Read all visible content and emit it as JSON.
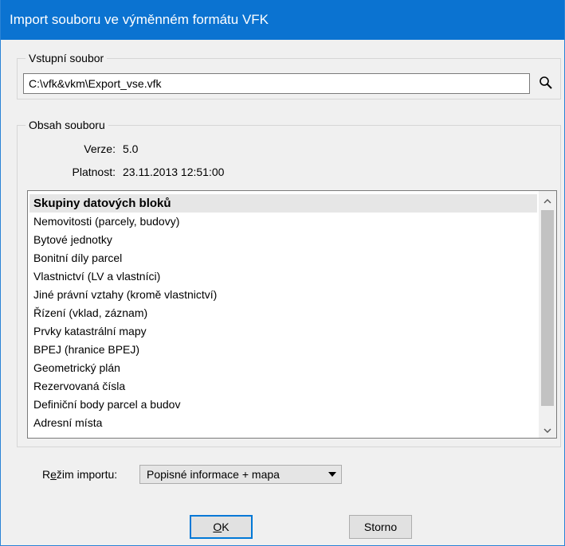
{
  "window": {
    "title": "Import souboru ve výměnném formátu VFK"
  },
  "input_file": {
    "group_label": "Vstupní soubor",
    "path": "C:\\vfk&vkm\\Export_vse.vfk",
    "browse_icon": "search-icon"
  },
  "content": {
    "group_label": "Obsah souboru",
    "version_label": "Verze:",
    "version_value": "5.0",
    "validity_label": "Platnost:",
    "validity_value": "23.11.2013 12:51:00",
    "list_header": "Skupiny datových bloků",
    "list_items": [
      "Nemovitosti (parcely, budovy)",
      "Bytové jednotky",
      "Bonitní díly parcel",
      "Vlastnictví  (LV a vlastníci)",
      "Jiné právní vztahy (kromě vlastnictví)",
      "Řízení (vklad, záznam)",
      "Prvky katastrální mapy",
      "BPEJ (hranice BPEJ)",
      "Geometrický plán",
      "Rezervovaná čísla",
      "Definiční body parcel a budov",
      "Adresní místa"
    ]
  },
  "import_mode": {
    "label_prefix": "R",
    "label_underlined": "e",
    "label_rest": "žim importu:",
    "selected": "Popisné informace + mapa"
  },
  "buttons": {
    "ok_underlined": "O",
    "ok_rest": "K",
    "cancel": "Storno"
  }
}
